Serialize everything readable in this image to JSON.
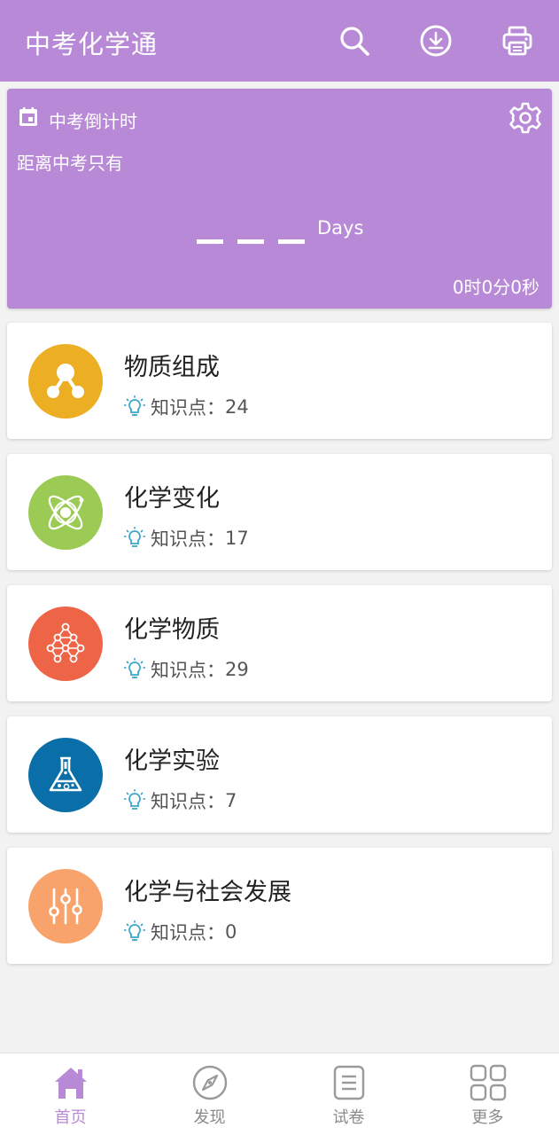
{
  "app": {
    "title": "中考化学通"
  },
  "header": {
    "search_icon": "search-icon",
    "download_icon": "download-icon",
    "print_icon": "printer-icon"
  },
  "countdown": {
    "title": "中考倒计时",
    "subtitle": "距离中考只有",
    "days_label": "Days",
    "time_left": "0时0分0秒",
    "icons": {
      "calendar": "calendar-icon",
      "settings": "gear-icon"
    }
  },
  "knowledge_label": "知识点：",
  "categories": [
    {
      "name": "物质组成",
      "count": "24",
      "color": "#ecaf24",
      "icon": "molecule-icon"
    },
    {
      "name": "化学变化",
      "count": "17",
      "color": "#9bcb54",
      "icon": "atom-icon"
    },
    {
      "name": "化学物质",
      "count": "29",
      "color": "#ee6447",
      "icon": "network-icon"
    },
    {
      "name": "化学实验",
      "count": "7",
      "color": "#0a6ea8",
      "icon": "flask-icon"
    },
    {
      "name": "化学与社会发展",
      "count": "0",
      "color": "#f8a36c",
      "icon": "sliders-icon"
    }
  ],
  "tabs": [
    {
      "label": "首页",
      "icon": "home-icon",
      "active": true
    },
    {
      "label": "发现",
      "icon": "compass-icon",
      "active": false
    },
    {
      "label": "试卷",
      "icon": "paper-icon",
      "active": false
    },
    {
      "label": "更多",
      "icon": "grid-icon",
      "active": false
    }
  ],
  "colors": {
    "primary": "#b789d6",
    "background": "#f2f2f2",
    "lightbulb": "#3aa6c9"
  }
}
